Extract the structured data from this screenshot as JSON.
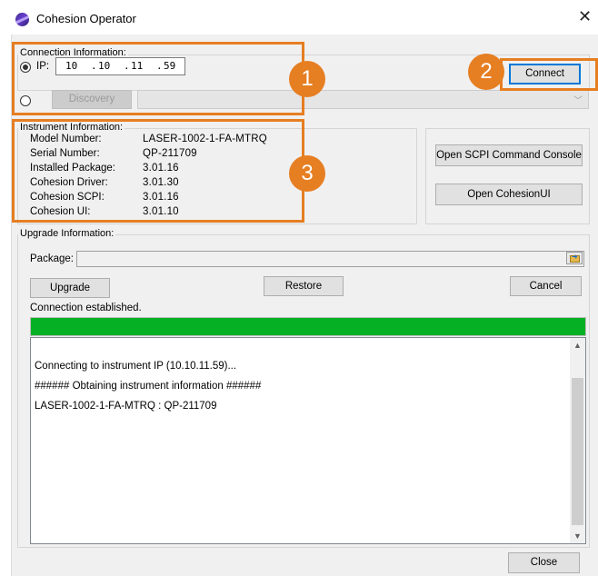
{
  "window": {
    "title": "Cohesion Operator",
    "close_glyph": "✕"
  },
  "connection": {
    "group_label": "Connection Information:",
    "ip_label": "IP:",
    "ip_octets": [
      "10",
      "10",
      "11",
      "59"
    ],
    "ip_mode_selected": true,
    "discovery_label": "Discovery",
    "connect_label": "Connect"
  },
  "instrument": {
    "group_label": "Instrument Information:",
    "rows": [
      {
        "label": "Model Number:",
        "value": "LASER-1002-1-FA-MTRQ"
      },
      {
        "label": "Serial Number:",
        "value": "QP-211709"
      },
      {
        "label": "Installed Package:",
        "value": "3.01.16"
      },
      {
        "label": "Cohesion Driver:",
        "value": "3.01.30"
      },
      {
        "label": "Cohesion SCPI:",
        "value": "3.01.16"
      },
      {
        "label": "Cohesion UI:",
        "value": "3.01.10"
      }
    ]
  },
  "tools": {
    "scpi_label": "Open SCPI Command Console",
    "ui_label": "Open CohesionUI"
  },
  "upgrade": {
    "group_label": "Upgrade Information:",
    "package_label": "Package:",
    "package_value": "",
    "upgrade_label": "Upgrade",
    "restore_label": "Restore",
    "cancel_label": "Cancel",
    "status_text": "Connection established.",
    "progress_fraction": 1.0,
    "log_lines": [
      "Connecting to instrument IP (10.10.11.59)...",
      "###### Obtaining instrument information ######",
      "LASER-1002-1-FA-MTRQ : QP-211709"
    ]
  },
  "footer": {
    "close_label": "Close"
  },
  "callouts": {
    "one": "1",
    "two": "2",
    "three": "3"
  },
  "colors": {
    "accent_orange": "#e67e22",
    "progress_green": "#06b025",
    "default_button_blue": "#0078d7"
  },
  "icons": {
    "app": "cohesion-app-icon",
    "close": "close-icon",
    "radio": "radio-icon",
    "dropdown": "chevron-down-icon",
    "browse": "folder-browse-icon",
    "scroll_up": "chevron-up-icon",
    "scroll_down": "chevron-down-icon"
  }
}
